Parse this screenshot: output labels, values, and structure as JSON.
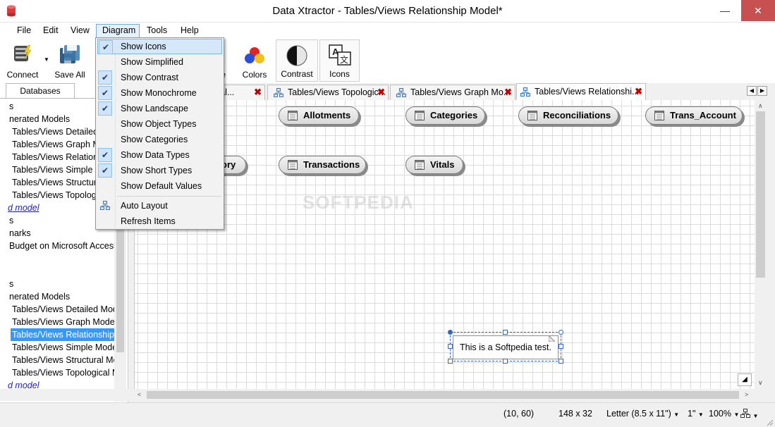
{
  "window": {
    "title": "Data Xtractor - Tables/Views Relationship Model*"
  },
  "menubar": [
    "File",
    "Edit",
    "View",
    "Diagram",
    "Tools",
    "Help"
  ],
  "toolbar": {
    "connect": "Connect",
    "save_all": "Save All",
    "partial": "te",
    "colors": "Colors",
    "contrast": "Contrast",
    "icons": "Icons"
  },
  "left_panel": {
    "tab": "Databases",
    "tree": [
      {
        "text": "s",
        "style": "normal"
      },
      {
        "text": "nerated Models",
        "style": "normal"
      },
      {
        "text": "Tables/Views Detailed",
        "style": "normal"
      },
      {
        "text": "Tables/Views Graph M",
        "style": "normal"
      },
      {
        "text": "Tables/Views Relations",
        "style": "normal"
      },
      {
        "text": "Tables/Views Simple M",
        "style": "normal"
      },
      {
        "text": "Tables/Views Structura",
        "style": "normal"
      },
      {
        "text": "Tables/Views Topolog",
        "style": "normal"
      },
      {
        "text": "d model",
        "style": "link"
      },
      {
        "text": "s",
        "style": "normal"
      },
      {
        "text": "narks",
        "style": "normal"
      },
      {
        "text": "Budget on Microsoft Access",
        "style": "normal"
      },
      {
        "text": "",
        "style": "normal"
      },
      {
        "text": "",
        "style": "normal"
      },
      {
        "text": "s",
        "style": "normal"
      },
      {
        "text": "nerated Models",
        "style": "normal"
      },
      {
        "text": "Tables/Views Detailed Mod",
        "style": "normal"
      },
      {
        "text": "Tables/Views Graph Model",
        "style": "normal"
      },
      {
        "text": "Tables/Views Relationship M",
        "style": "selected"
      },
      {
        "text": "Tables/Views Simple Model",
        "style": "normal"
      },
      {
        "text": "Tables/Views Structural Mo",
        "style": "normal"
      },
      {
        "text": "Tables/Views Topological M",
        "style": "normal"
      },
      {
        "text": "d model",
        "style": "link"
      }
    ]
  },
  "doc_tabs": [
    {
      "label": "ural...",
      "active": false
    },
    {
      "label": "Tables/Views Topologic...",
      "active": false
    },
    {
      "label": "Tables/Views Graph Mo...",
      "active": false
    },
    {
      "label": "Tables/Views Relationshi...",
      "active": true
    }
  ],
  "diagram": {
    "entities": [
      "Allotments",
      "Categories",
      "Reconciliations",
      "Trans_Account",
      "ory",
      "Transactions",
      "Vitals"
    ],
    "note": "This is a Softpedia test.",
    "watermark": "SOFTPEDIA"
  },
  "dropdown": {
    "items": [
      {
        "label": "Show Icons",
        "checked": true
      },
      {
        "label": "Show Simplified",
        "checked": false
      },
      {
        "label": "Show Contrast",
        "checked": true
      },
      {
        "label": "Show Monochrome",
        "checked": true
      },
      {
        "label": "Show Landscape",
        "checked": true
      },
      {
        "label": "Show Object Types",
        "checked": false
      },
      {
        "label": "Show Categories",
        "checked": false
      },
      {
        "label": "Show Data Types",
        "checked": true
      },
      {
        "label": "Show Short Types",
        "checked": true
      },
      {
        "label": "Show Default Values",
        "checked": false
      },
      {
        "label": "Auto Layout",
        "checked": false
      },
      {
        "label": "Refresh Items",
        "checked": false
      }
    ]
  },
  "status": {
    "coords": "(10, 60)",
    "size": "148 x 32",
    "paper": "Letter (8.5 x 11\")",
    "grid": "1\"",
    "zoom": "100%"
  },
  "colors": {
    "accent": "#3399ff",
    "tab_close": "#c00000",
    "close_button": "#c75050"
  }
}
